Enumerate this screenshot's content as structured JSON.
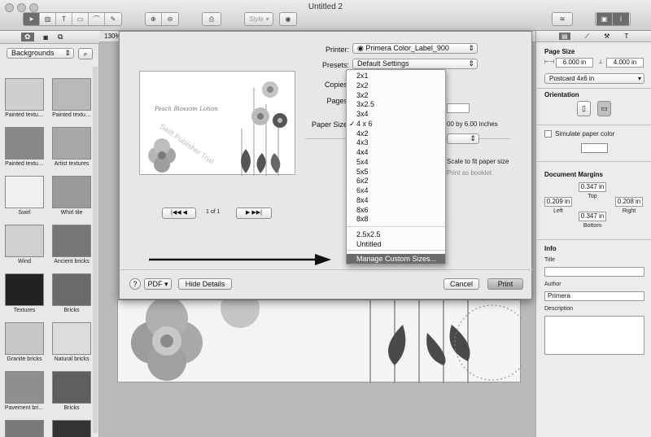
{
  "window": {
    "title": "Untitled 2"
  },
  "toolbar": {
    "zoom": "130%",
    "style_label": "Style"
  },
  "left": {
    "category": "Backgrounds",
    "thumbs": [
      "Painted textu…",
      "Painted textu…",
      "Painted textu…",
      "Artist textures",
      "Swirl",
      "Whirl tile",
      "Wind",
      "Ancient bricks",
      "Textures",
      "Bricks",
      "Granite bricks",
      "Natural bricks",
      "Pavement bri…",
      "Bricks"
    ]
  },
  "print": {
    "printer_label": "Printer:",
    "printer_value": "Primera Color_Label_900",
    "presets_label": "Presets:",
    "presets_value": "Default Settings",
    "copies_label": "Copies",
    "pages_label": "Pages",
    "paper_size_label": "Paper Size",
    "paper_dims": "00 by 6.00 inches",
    "scale_to_fit": "Scale to fit paper size",
    "print_as_booklet": "Print as booklet",
    "page_nav": "1 of 1",
    "preview_caption": "Peach Blossom Lotion",
    "preview_brand": "Swift Publisher Trial",
    "pdf_label": "PDF",
    "hide_details": "Hide Details",
    "cancel": "Cancel",
    "print": "Print",
    "help": "?"
  },
  "menu": {
    "items": [
      "2x1",
      "2x2",
      "3x2",
      "3x2.5",
      "3x4",
      "4 x 6",
      "4x2",
      "4x3",
      "4x4",
      "5x4",
      "5x5",
      "6x2",
      "6x4",
      "8x4",
      "8x6",
      "8x8"
    ],
    "checked_index": 5,
    "check": "✓",
    "extra": [
      "2.5x2.5",
      "Untitled"
    ],
    "manage": "Manage Custom Sizes..."
  },
  "right": {
    "page_size_title": "Page Size",
    "width": "6.000 in",
    "height": "4.000 in",
    "page_preset": "Postcard 4x6 in",
    "orientation_title": "Orientation",
    "simulate": "Simulate paper color",
    "margins_title": "Document Margins",
    "margin_top": "0.347 in",
    "margin_left": "0.209 in",
    "margin_right": "0.208 in",
    "margin_bottom": "0.347 in",
    "top_label": "Top",
    "left_label": "Left",
    "right_label": "Right",
    "bottom_label": "Bottom",
    "info_title": "Info",
    "title_label": "Title",
    "author_label": "Author",
    "author_value": "Primera",
    "description_label": "Description"
  },
  "colors": {
    "menu_highlight": "#6b6b6b",
    "accent": "#3d7be0"
  }
}
